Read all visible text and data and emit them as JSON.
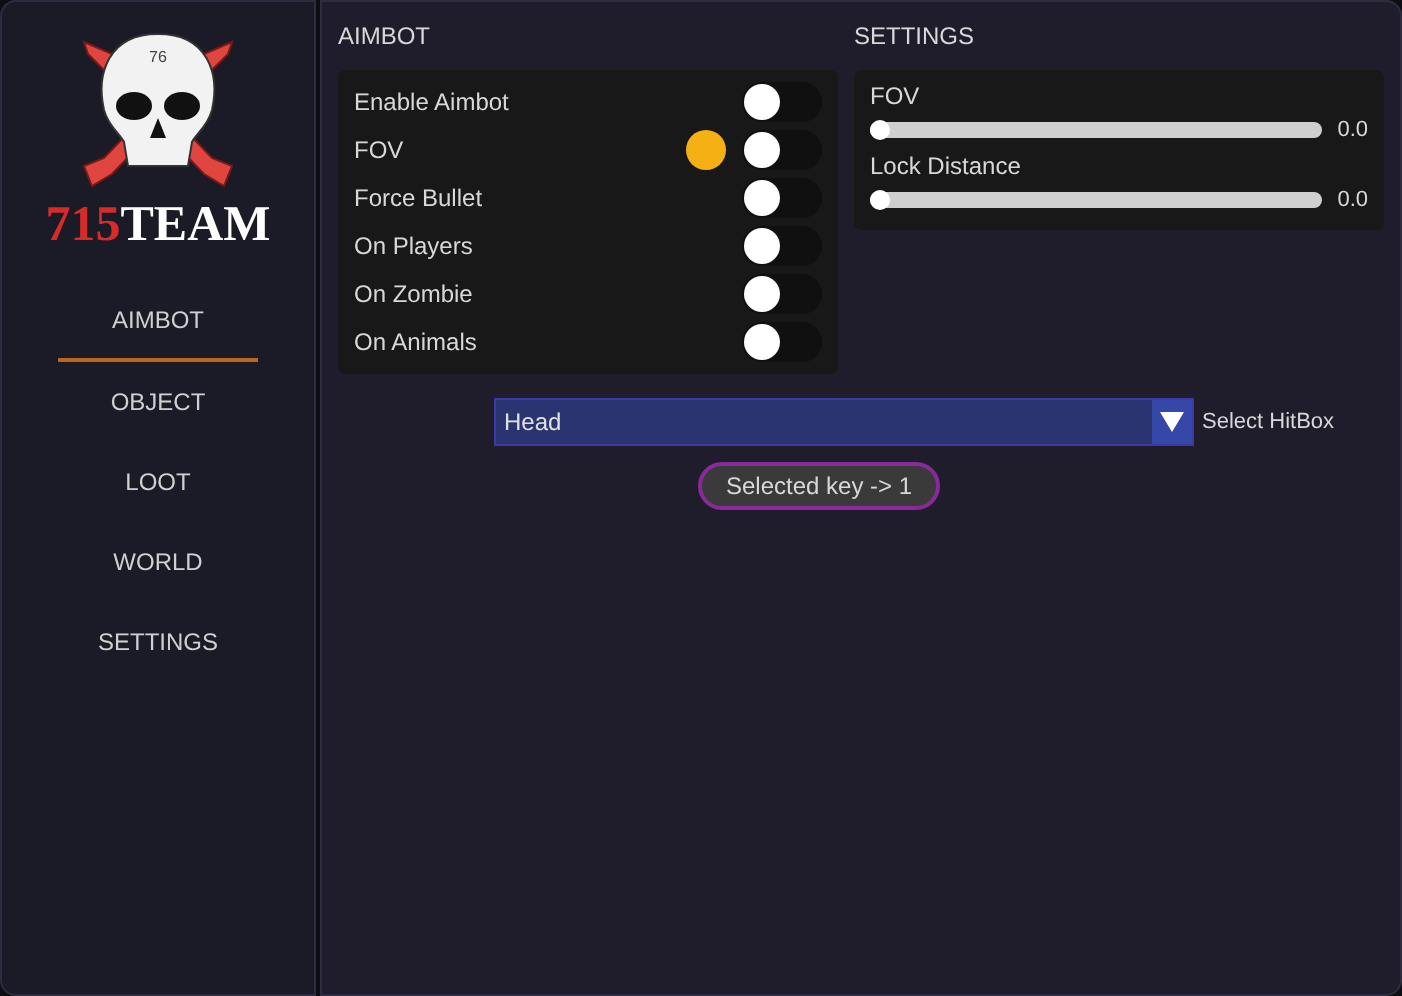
{
  "logo": {
    "skull_mark": "76",
    "number": "715",
    "word": "TEAM"
  },
  "sidebar": {
    "items": [
      {
        "label": "AIMBOT",
        "selected": true
      },
      {
        "label": "OBJECT",
        "selected": false
      },
      {
        "label": "LOOT",
        "selected": false
      },
      {
        "label": "WORLD",
        "selected": false
      },
      {
        "label": "SETTINGS",
        "selected": false
      }
    ]
  },
  "aimbot": {
    "title": "AIMBOT",
    "toggles": [
      {
        "label": "Enable Aimbot",
        "on": false,
        "dot": false
      },
      {
        "label": "FOV",
        "on": false,
        "dot": true
      },
      {
        "label": "Force Bullet",
        "on": false,
        "dot": false
      },
      {
        "label": "On Players",
        "on": false,
        "dot": false
      },
      {
        "label": "On Zombie",
        "on": false,
        "dot": false
      },
      {
        "label": "On Animals",
        "on": false,
        "dot": false
      }
    ]
  },
  "settings": {
    "title": "SETTINGS",
    "sliders": [
      {
        "label": "FOV",
        "level": 0,
        "reading": "0.0"
      },
      {
        "label": "Lock Distance",
        "level": 0,
        "reading": "0.0"
      }
    ]
  },
  "hitbox": {
    "value": "Head",
    "label": "Select HitBox"
  },
  "key_button": "Selected key -> 1"
}
